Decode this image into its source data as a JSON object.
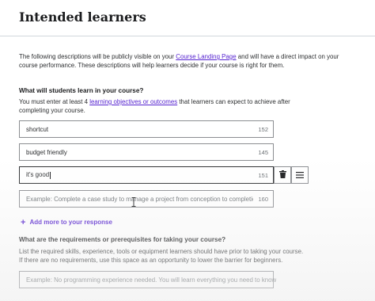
{
  "page": {
    "title": "Intended learners",
    "intro": {
      "part1": "The following descriptions will be publicly visible on your ",
      "link": "Course Landing Page",
      "part2": " and will have a direct impact on your course performance. These descriptions will help learners decide if your course is right for them."
    }
  },
  "objectives": {
    "heading": "What will students learn in your course?",
    "instruction": {
      "part1": "You must enter at least 4 ",
      "link": "learning objectives or outcomes",
      "part2": " that learners can expect to achieve after completing your course."
    },
    "items": [
      {
        "value": "shortcut",
        "count": "152"
      },
      {
        "value": "budget friendly",
        "count": "145"
      },
      {
        "value": "it's good",
        "count": "151"
      },
      {
        "placeholder": "Example: Complete a case study to manage a project from conception to completion",
        "count": "160"
      }
    ],
    "add_more_label": "Add more to your response"
  },
  "requirements": {
    "heading": "What are the requirements or prerequisites for taking your course?",
    "instruction": "List the required skills, experience, tools or equipment learners should have prior to taking your course. If there are no requirements, use this space as an opportunity to lower the barrier for beginners.",
    "placeholder": "Example: No programming experience needed. You will learn everything you need to know"
  },
  "icons": {
    "delete": "trash-icon",
    "reorder": "hamburger-icon",
    "add": "plus-icon"
  },
  "colors": {
    "link": "#5624d0",
    "border": "#8b8d91",
    "text": "#2d2f31"
  }
}
